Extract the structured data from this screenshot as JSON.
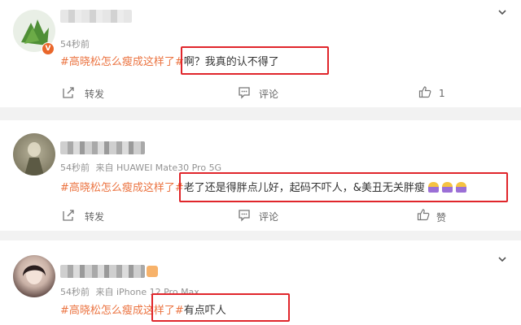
{
  "comments": [
    {
      "time": "54秒前",
      "device": "",
      "topic": "#高晓松怎么瘦成这样了#",
      "text": "啊？我真的认不得了",
      "actions": {
        "repost": "转发",
        "comment": "评论",
        "like": "1"
      }
    },
    {
      "time": "54秒前",
      "device": "来自 HUAWEI Mate30 Pro 5G",
      "topic": "#高晓松怎么瘦成这样了#",
      "text": "老了还是得胖点儿好，起码不吓人，&美丑无关胖瘦",
      "actions": {
        "repost": "转发",
        "comment": "评论",
        "like": "赞"
      }
    },
    {
      "time": "54秒前",
      "device": "来自 iPhone 12 Pro Max",
      "topic": "#高晓松怎么瘦成这样了#",
      "text": "有点吓人"
    }
  ],
  "icons": {
    "expand": "chevron-down-icon",
    "repost": "share-icon",
    "comment": "comment-icon",
    "like": "thumbs-up-icon",
    "verified": "verified-badge-icon"
  },
  "colors": {
    "topic": "#eb7340",
    "highlight": "#e0262b",
    "meta": "#939393"
  }
}
